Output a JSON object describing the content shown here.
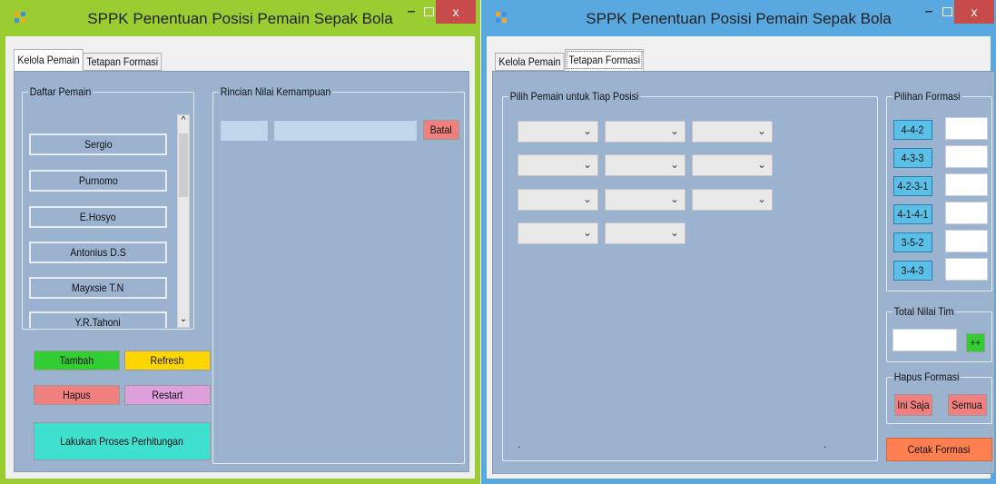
{
  "window_left": {
    "title": "SPPK Penentuan Posisi Pemain Sepak Bola",
    "close_label": "x",
    "minimize_label": "–",
    "tabs": [
      "Kelola Pemain",
      "Tetapan Formasi"
    ],
    "daftar_pemain": {
      "label": "Daftar Pemain",
      "players": [
        "Sergio",
        "Purnomo",
        "E.Hosyo",
        "Antonius D.S",
        "Mayxsie T.N",
        "Y.R.Tahoni"
      ]
    },
    "rincian": {
      "label": "Rincian Nilai Kemampuan",
      "batal_label": "Batal"
    },
    "buttons": {
      "tambah": "Tambah",
      "refresh": "Refresh",
      "hapus": "Hapus",
      "restart": "Restart",
      "proses": "Lakukan Proses Perhitungan"
    },
    "colors": {
      "tambah": "#32cd32",
      "refresh": "#ffd700",
      "hapus": "#f08080",
      "restart": "#dda0dd",
      "proses": "#40e0d0",
      "batal": "#f08080"
    }
  },
  "window_right": {
    "title": "SPPK Penentuan Posisi Pemain Sepak Bola",
    "close_label": "x",
    "minimize_label": "–",
    "tabs": [
      "Kelola Pemain",
      "Tetapan Formasi"
    ],
    "pilih_pemain": {
      "label": "Pilih Pemain untuk Tiap Posisi",
      "dot": "."
    },
    "pilihan_formasi": {
      "label": "Pilihan Formasi",
      "options": [
        "4-4-2",
        "4-3-3",
        "4-2-3-1",
        "4-1-4-1",
        "3-5-2",
        "3-4-3"
      ]
    },
    "total_nilai": {
      "label": "Total Nilai Tim",
      "button": "++"
    },
    "hapus_formasi": {
      "label": "Hapus Formasi",
      "ini_saja": "Ini Saja",
      "semua": "Semua"
    },
    "cetak_label": "Cetak Formasi",
    "colors": {
      "plus": "#32cd32",
      "ini_saja": "#f08080",
      "semua": "#f08080",
      "cetak": "#ff7f50",
      "formasi": "#5bc0e8"
    }
  }
}
